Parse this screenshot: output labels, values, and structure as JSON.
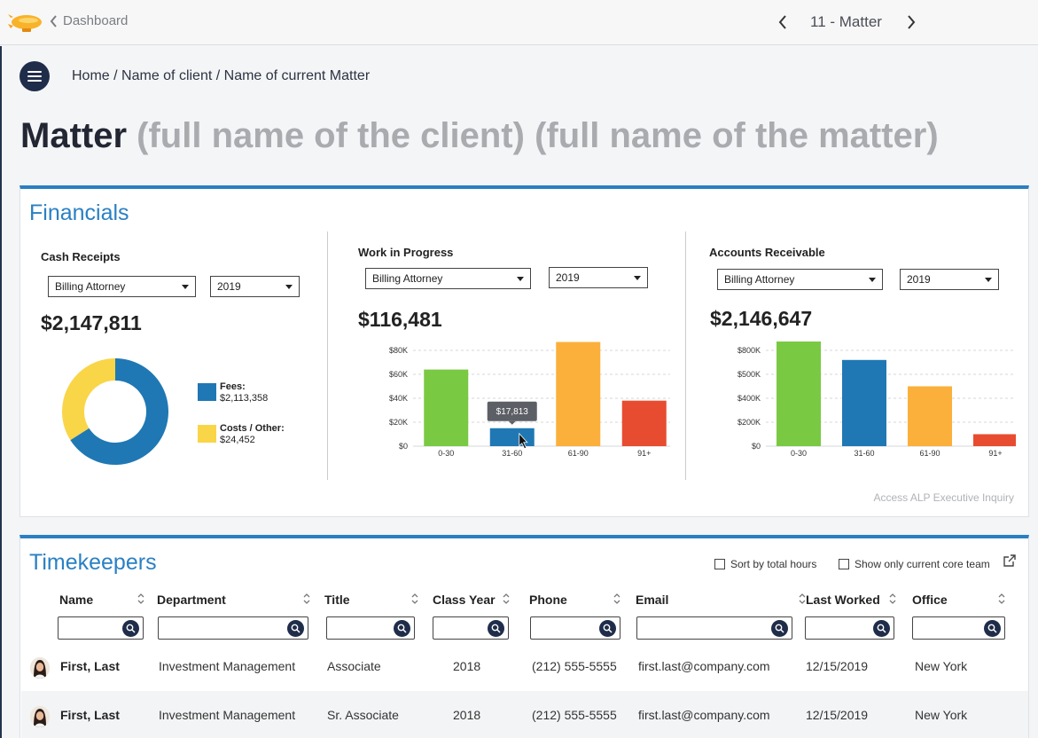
{
  "topbar": {
    "back_label": "Dashboard",
    "pager_label": "11 - Matter"
  },
  "breadcrumb": {
    "home": "Home",
    "client": "Name of client",
    "matter": "Name of current Matter",
    "separator": " / "
  },
  "page_title": {
    "main": "Matter",
    "subtitle": "(full name of the client) (full name of the matter)"
  },
  "financials": {
    "title": "Financials",
    "footer_link": "Access ALP Executive Inquiry",
    "cash_receipts": {
      "title": "Cash Receipts",
      "filter_label": "Billing Attorney",
      "year": "2019",
      "amount": "$2,147,811",
      "legend": [
        {
          "label": "Fees:",
          "value": "$2,113,358",
          "color": "#1f78b4"
        },
        {
          "label": "Costs / Other:",
          "value": "$24,452",
          "color": "#f9d548"
        }
      ]
    },
    "wip": {
      "title": "Work in Progress",
      "filter_label": "Billing Attorney",
      "year": "2019",
      "amount": "$116,481",
      "tooltip": "$17,813"
    },
    "ar": {
      "title": "Accounts Receivable",
      "filter_label": "Billing Attorney",
      "year": "2019",
      "amount": "$2,146,647"
    }
  },
  "chart_data": [
    {
      "type": "pie",
      "title": "Cash Receipts",
      "labels": [
        "Fees",
        "Costs / Other"
      ],
      "values": [
        2113358,
        24452
      ],
      "colors": [
        "#1f78b4",
        "#f9d548"
      ]
    },
    {
      "type": "bar",
      "title": "Work in Progress",
      "categories": [
        "0-30",
        "31-60",
        "61-90",
        "91+"
      ],
      "values": [
        64000,
        15000,
        87000,
        38000
      ],
      "colors": [
        "#7ac943",
        "#1f78b4",
        "#fbb03b",
        "#e84c30"
      ],
      "yticks": [
        "$0",
        "$20K",
        "$40K",
        "$60K",
        "$80K"
      ],
      "ylim": [
        0,
        80000
      ],
      "grid": true
    },
    {
      "type": "bar",
      "title": "Accounts Receivable",
      "categories": [
        "0-30",
        "31-60",
        "61-90",
        "91+"
      ],
      "values": [
        890000,
        720000,
        500000,
        100000
      ],
      "colors": [
        "#7ac943",
        "#1f78b4",
        "#fbb03b",
        "#e84c30"
      ],
      "yticks": [
        "$0",
        "$200K",
        "$400K",
        "$500K",
        "$800K"
      ],
      "ytick_values": [
        0,
        200000,
        400000,
        600000,
        800000
      ],
      "ylim": [
        0,
        800000
      ],
      "grid": true
    }
  ],
  "timekeepers": {
    "title": "Timekeepers",
    "opt_sort": "Sort by total hours",
    "opt_core": "Show only current core team",
    "columns": [
      "Name",
      "Department",
      "Title",
      "Class Year",
      "Phone",
      "Email",
      "Last Worked",
      "Office"
    ],
    "rows": [
      {
        "name": "First, Last",
        "department": "Investment Management",
        "title": "Associate",
        "class_year": "2018",
        "phone": "(212) 555-5555",
        "email": "first.last@company.com",
        "last_worked": "12/15/2019",
        "office": "New York"
      },
      {
        "name": "First, Last",
        "department": "Investment Management",
        "title": "Sr. Associate",
        "class_year": "2018",
        "phone": "(212) 555-5555",
        "email": "first.last@company.com",
        "last_worked": "12/15/2019",
        "office": "New York"
      }
    ]
  },
  "colors": {
    "accent": "#2a80c4",
    "navy": "#1f2d4a"
  },
  "icons": [
    "blimp-logo",
    "chevron-left-icon",
    "chevron-right-icon",
    "hamburger-menu-icon",
    "caret-down-icon",
    "sort-icon",
    "search-icon",
    "external-link-icon",
    "cursor-icon"
  ]
}
